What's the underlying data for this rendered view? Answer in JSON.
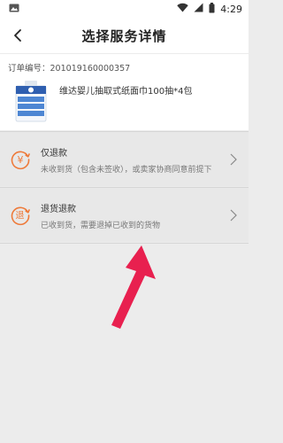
{
  "status_bar": {
    "time": "4:29",
    "icons": [
      "image-icon",
      "wifi-icon",
      "signal-icon",
      "battery-icon"
    ]
  },
  "header": {
    "title": "选择服务详情",
    "back_icon": "chevron-left-icon"
  },
  "order": {
    "number_label": "订单编号：",
    "number_value": "201019160000357",
    "product_name": "维达婴儿抽取式纸面巾100抽*4包"
  },
  "options": [
    {
      "icon": "refund-yen-icon",
      "icon_glyph": "¥",
      "title": "仅退款",
      "description": "未收到货（包含未签收），或卖家协商同意前提下"
    },
    {
      "icon": "return-refund-icon",
      "icon_glyph": "退",
      "title": "退货退款",
      "description": "已收到货，需要退掉已收到的货物"
    }
  ],
  "colors": {
    "accent_orange": "#ee7a3a",
    "annotation_red": "#e8204f"
  }
}
